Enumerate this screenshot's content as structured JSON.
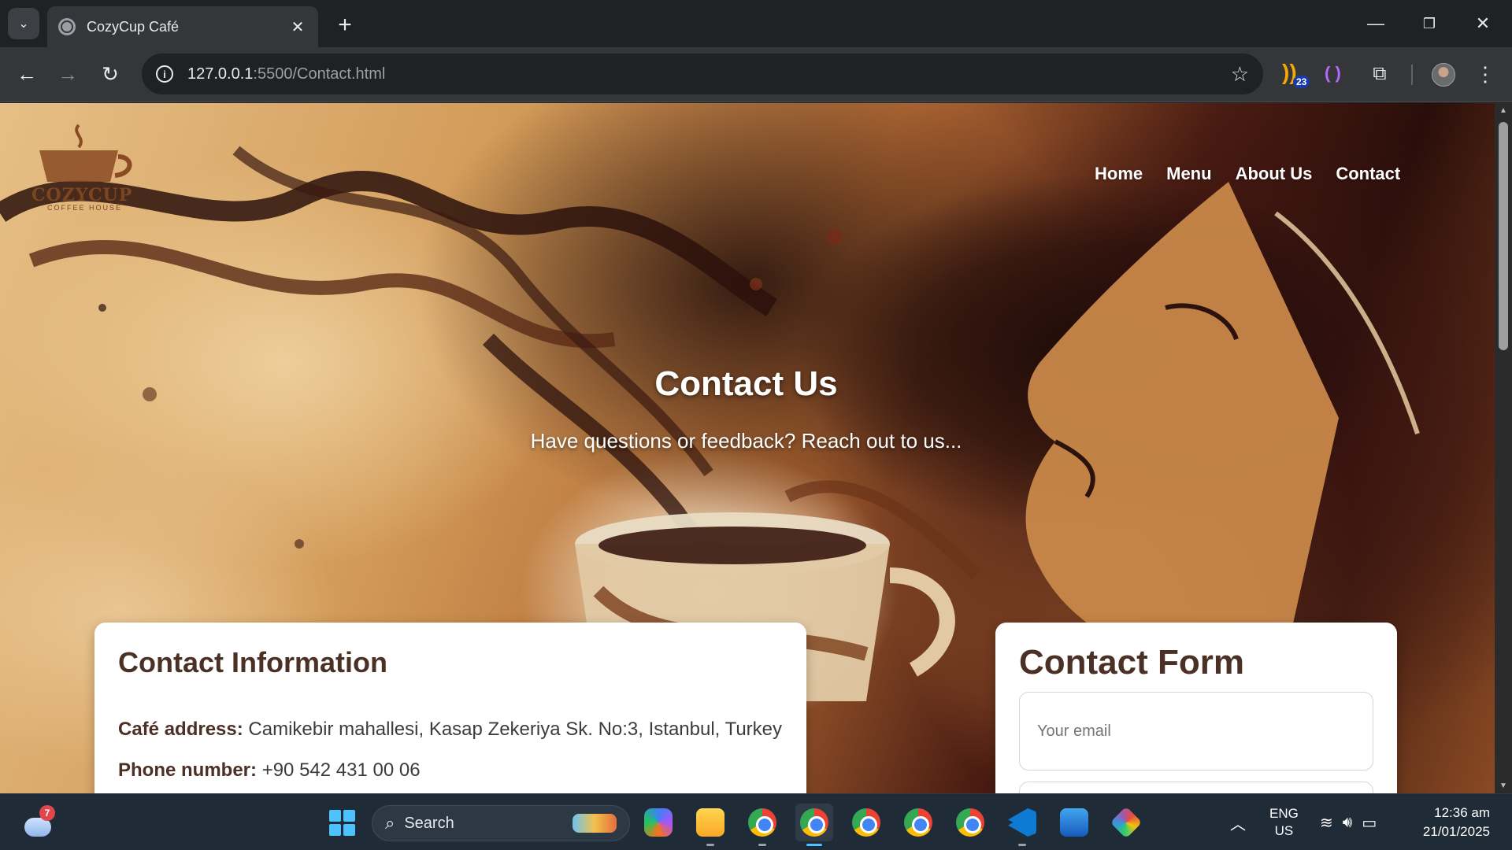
{
  "browser": {
    "tab_title": "CozyCup Café",
    "tab_close": "✕",
    "new_tab": "+",
    "url_host": "127.0.0.1",
    "url_path": ":5500/Contact.html",
    "extension_badge": "23",
    "window_controls": [
      "—",
      "❐",
      "✕"
    ]
  },
  "site": {
    "logo_brand": "COZYCUP",
    "logo_sub": "COFFEE HOUSE",
    "nav": [
      "Home",
      "Menu",
      "About Us",
      "Contact"
    ],
    "hero_title": "Contact Us",
    "hero_subtitle": "Have questions or feedback? Reach out to us...",
    "contact_info": {
      "heading": "Contact Information",
      "address_label": "Café address:",
      "address_value": "Camikebir mahallesi, Kasap Zekeriya Sk. No:3, Istanbul, Turkey",
      "phone_label": "Phone number:",
      "phone_value": "+90 542 431 00 06"
    },
    "contact_form": {
      "heading": "Contact Form",
      "email_placeholder": "Your email"
    }
  },
  "taskbar": {
    "weather_badge": "7",
    "search_label": "Search",
    "lang_top": "ENG",
    "lang_bottom": "US",
    "time": "12:36 am",
    "date": "21/01/2025"
  },
  "colors": {
    "accent": "#4a3025",
    "chrome_dark": "#202124",
    "taskbar": "#1f2b37"
  }
}
